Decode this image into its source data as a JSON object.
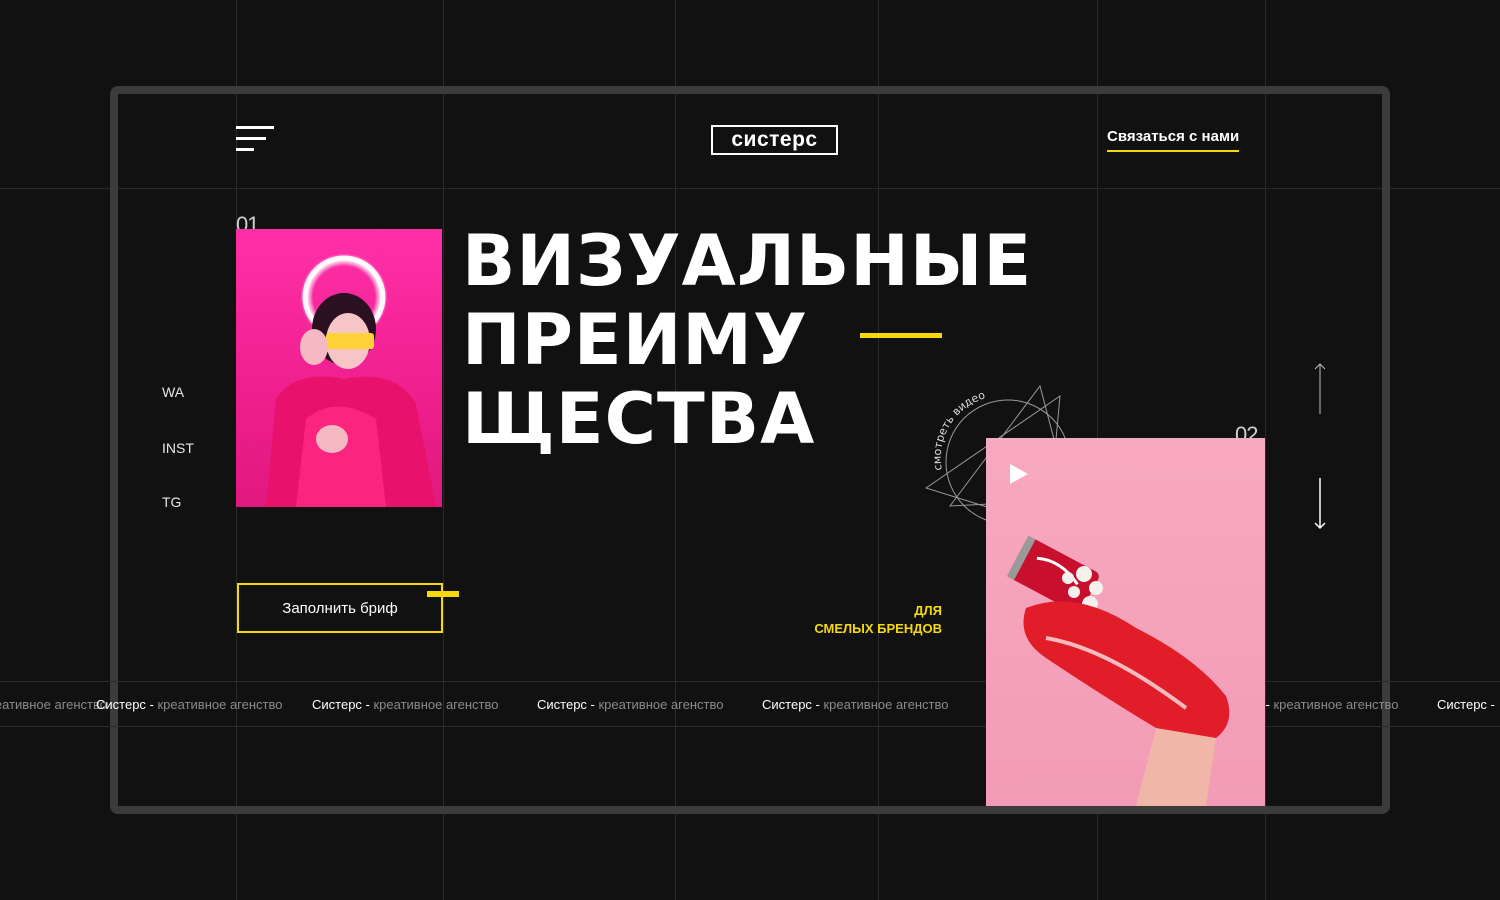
{
  "header": {
    "logo": "систерс",
    "contact_label": "Связаться с нами"
  },
  "hero": {
    "number_1": "01",
    "number_2": "02",
    "headline": [
      "ВИЗУАЛЬНЫЕ",
      "ПРЕИМУ",
      "ЩЕСТВА"
    ],
    "brief_button": "Заполнить бриф",
    "tagline_line1": "ДЛЯ",
    "tagline_line2": "СМЕЛЫХ БРЕНДОВ",
    "video_label": "смотреть видео"
  },
  "social": [
    "WA",
    "INST",
    "TG"
  ],
  "ticker": {
    "brand": "Систерс",
    "separator": " - ",
    "text": "креативное агенство"
  },
  "colors": {
    "background": "#111111",
    "accent": "#f5d90a",
    "frame": "#3b3b3b"
  },
  "icons": [
    "menu-icon",
    "play-icon",
    "arrow-up-icon",
    "arrow-down-icon"
  ]
}
